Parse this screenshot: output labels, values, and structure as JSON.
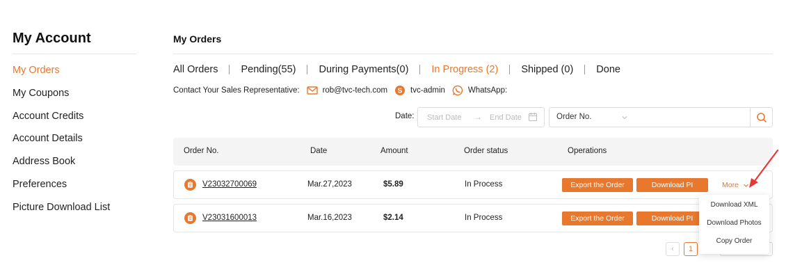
{
  "sidebar": {
    "title": "My Account",
    "items": [
      {
        "label": "My Orders",
        "active": true
      },
      {
        "label": "My Coupons"
      },
      {
        "label": "Account Credits"
      },
      {
        "label": "Account Details"
      },
      {
        "label": "Address Book"
      },
      {
        "label": "Preferences"
      },
      {
        "label": "Picture Download List"
      }
    ]
  },
  "main": {
    "title": "My Orders",
    "tabs": [
      {
        "label": "All Orders"
      },
      {
        "label": "Pending(55)"
      },
      {
        "label": "During Payments(0)"
      },
      {
        "label": "In Progress (2)",
        "active": true
      },
      {
        "label": "Shipped (0)"
      },
      {
        "label": "Done"
      }
    ],
    "contact": {
      "label": "Contact Your Sales Representative:",
      "email": "rob@tvc-tech.com",
      "skype": "tvc-admin",
      "whatsapp": "WhatsApp:"
    },
    "filter": {
      "date_label": "Date:",
      "start_placeholder": "Start Date",
      "arrow": "→",
      "end_placeholder": "End Date",
      "select_value": "Order No.",
      "search_placeholder": ""
    },
    "table": {
      "headers": [
        "Order No.",
        "Date",
        "Amount",
        "Order status",
        "Operations"
      ],
      "rows": [
        {
          "order_no": "V23032700069",
          "date": "Mar.27,2023",
          "amount": "$5.89",
          "status": "In Process",
          "export_label": "Export the Order",
          "download_label": "Download PI",
          "more_label": "More"
        },
        {
          "order_no": "V23031600013",
          "date": "Mar.16,2023",
          "amount": "$2.14",
          "status": "In Process",
          "export_label": "Export the Order",
          "download_label": "Download PI"
        }
      ]
    },
    "more_menu": [
      "Download XML",
      "Download Photos",
      "Copy Order"
    ],
    "pagination": {
      "prev": "‹",
      "current": "1"
    }
  },
  "colors": {
    "accent": "#e8782e",
    "annotation": "#e53935"
  }
}
